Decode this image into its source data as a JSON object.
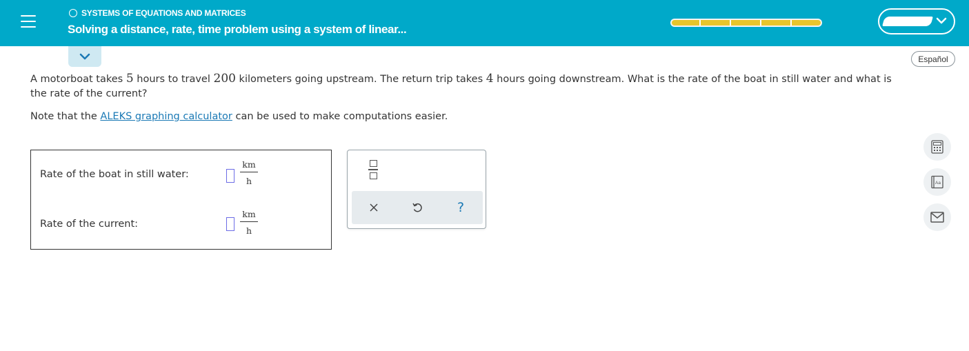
{
  "header": {
    "topic": "SYSTEMS OF EQUATIONS AND MATRICES",
    "title": "Solving a distance, rate, time problem using a system of linear...",
    "progress": {
      "segments": 5,
      "filled_fraction": 1.0
    }
  },
  "language_button": "Español",
  "problem": {
    "part1": "A motorboat takes ",
    "hours_up": "5",
    "part2": " hours to travel ",
    "distance": "200",
    "part3": " kilometers going upstream. The return trip takes ",
    "hours_down": "4",
    "part4": " hours going downstream. What is the rate of the boat in still water and what is the rate of the current?"
  },
  "note": {
    "before": "Note that the ",
    "link": "ALEKS graphing calculator",
    "after": " can be used to make computations easier."
  },
  "answers": [
    {
      "label": "Rate of the boat in still water:",
      "value": "",
      "unit_num": "km",
      "unit_den": "h"
    },
    {
      "label": "Rate of the current:",
      "value": "",
      "unit_num": "km",
      "unit_den": "h"
    }
  ],
  "keypad": {
    "fraction_icon": "fraction-icon",
    "clear_icon": "x-icon",
    "undo_icon": "undo-icon",
    "help_label": "?"
  },
  "side_tools": [
    "calculator-icon",
    "dictionary-icon",
    "mail-icon"
  ],
  "colors": {
    "header_bg": "#00a9c9",
    "progress_fill": "#e8c52c",
    "link": "#1a79b5",
    "input_border": "#6c6ce6"
  }
}
